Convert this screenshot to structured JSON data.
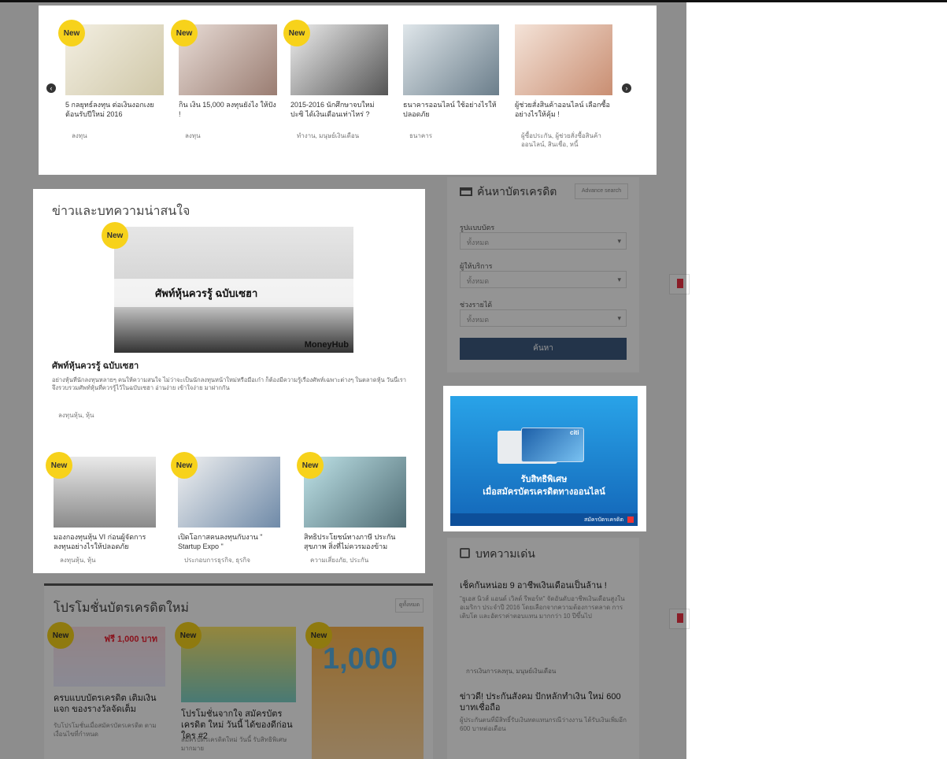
{
  "carousel": {
    "prev_icon": "chevron-left-icon",
    "next_icon": "chevron-right-icon",
    "items": [
      {
        "badge": "New",
        "title": "5 กลยุทธ์ลงทุน ต่อเงินงอกเงย ต้อนรับปีใหม่ 2016",
        "tags": "ลงทุน"
      },
      {
        "badge": "New",
        "title": "กิน เงิน 15,000 ลงทุนยังไง ให้ปัง !",
        "tags": "ลงทุน"
      },
      {
        "badge": "New",
        "title": "2015-2016 นักศึกษาจบใหม่ ปะซิ ได้เงินเดือนเท่าไหร่ ?",
        "tags": "ทำงาน, มนุษย์เงินเดือน"
      },
      {
        "badge": "",
        "title": "ธนาคารออนไลน์ ใช้อย่างไรให้ปลอดภัย",
        "tags": "ธนาคาร"
      },
      {
        "badge": "",
        "title": "ผู้ช่วยสั่งสินค้าออนไลน์ เลือกซื้ออย่างไรให้คุ้ม !",
        "tags": "ผู้ซื้อประกัน, ผู้ช่วยสั่งซื้อสินค้าออนไลน์, สินเชื่อ, หนี้"
      }
    ]
  },
  "news": {
    "heading": "ข่าวและบทความน่าสนใจ",
    "main": {
      "badge": "New",
      "image_caption": "ศัพท์หุ้นควรรู้ ฉบับเซฮา",
      "image_logo": "MoneyHub",
      "title": "ศัพท์หุ้นควรรู้ ฉบับเซฮา",
      "body": "อย่างหุ้นที่นักลงทุนหลายๆ คนให้ความสนใจ ไม่ว่าจะเป็นนักลงทุนหน้าใหม่หรือมือเก๋า ก็ต้องมีความรู้เรื่องศัพท์เฉพาะต่างๆ ในตลาดหุ้น วันนี้เราจึงรวบรวมศัพท์หุ้นที่ควรรู้ไว้ในฉบับเซฮา อ่านง่าย เข้าใจง่าย มาฝากกัน",
      "tags": "ลงทุนหุ้น, หุ้น"
    },
    "items": [
      {
        "badge": "New",
        "title": "มองกองทุนหุ้น VI ก่อนผู้จัดการ ลงทุนอย่างไรให้ปลอดภัย",
        "tags": "ลงทุนหุ้น, หุ้น"
      },
      {
        "badge": "New",
        "title": "เปิดโอกาสคนลงทุนกับงาน \" Startup Expo \"",
        "tags": "ประกอบการธุรกิจ, ธุรกิจ"
      },
      {
        "badge": "New",
        "title": "สิทธิประโยชน์ทางภาษี ประกันสุขภาพ สิ่งที่ไม่ควรมองข้าม",
        "tags": "ความเสี่ยงภัย, ประกัน"
      }
    ]
  },
  "promo": {
    "heading": "โปรโมชั่นบัตรเครดิตใหม่",
    "more_label": "ดูทั้งหมด",
    "items": [
      {
        "badge": "New",
        "image_text": "ฟรี 1,000 บาท",
        "title": "ครบแบบบัตรเครดิต เติมเงิน แจก ของรางวัลจัดเต็ม",
        "desc": "รับโปรโมชั่นเมื่อสมัครบัตรเครดิต ตามเงื่อนไขที่กำหนด"
      },
      {
        "badge": "New",
        "image_text": "",
        "title": "โปรโมชั่นจากใจ สมัครบัตรเครดิต ใหม่ วันนี้ ได้ของดีก่อนใคร #2",
        "desc": "สมัครบัตรเครดิตใหม่ วันนี้ รับสิทธิพิเศษมากมาย"
      },
      {
        "badge": "New",
        "image_text": "1,000",
        "title": "",
        "desc": ""
      }
    ]
  },
  "search": {
    "heading": "ค้นหาบัตรเครดิต",
    "advanced_label": "Advance search",
    "fields": [
      {
        "label": "รูปแบบบัตร",
        "value": "ทั้งหมด"
      },
      {
        "label": "ผู้ให้บริการ",
        "value": "ทั้งหมด"
      },
      {
        "label": "ช่วงรายได้",
        "value": "ทั้งหมด"
      }
    ],
    "submit_label": "ค้นหา"
  },
  "ad": {
    "card_brand": "citi",
    "line1": "รับสิทธิพิเศษ",
    "line2": "เมื่อสมัครบัตรเครดิตทางออนไลน์",
    "footer": "สมัครบัตรเครดิต"
  },
  "popular": {
    "heading": "บทความเด่น",
    "items": [
      {
        "title": "เช็คกันหน่อย 9 อาชีพเงินเดือนเป็นล้าน !",
        "desc": "\"ยูเอส นิวส์ แอนด์ เวิลด์ รีพอร์ท\" จัดอันดับอาชีพเงินเดือนสูงในอเมริกา ประจำปี 2016 โดยเลือกจากความต้องการตลาด การเติบโต และอัตราค่าตอบแทน มากกว่า 10 ปีขึ้นไป",
        "tags": "การเงินการลงทุน, มนุษย์เงินเดือน"
      },
      {
        "title": "ข่าวดี! ประกันสังคม ปักหลักทำเงิน ใหม่ 600 บาทเชื่อถือ",
        "desc": "ผู้ประกันตนที่มีสิทธิ์รับเงินทดแทนกรณีว่างงาน ได้รับเงินเพิ่มอีก 600 บาทต่อเดือน",
        "tags": ""
      }
    ]
  },
  "colors": {
    "badge": "#f7d21b",
    "ad_blue": "#1e88d6",
    "search_button": "#3d5a80"
  }
}
